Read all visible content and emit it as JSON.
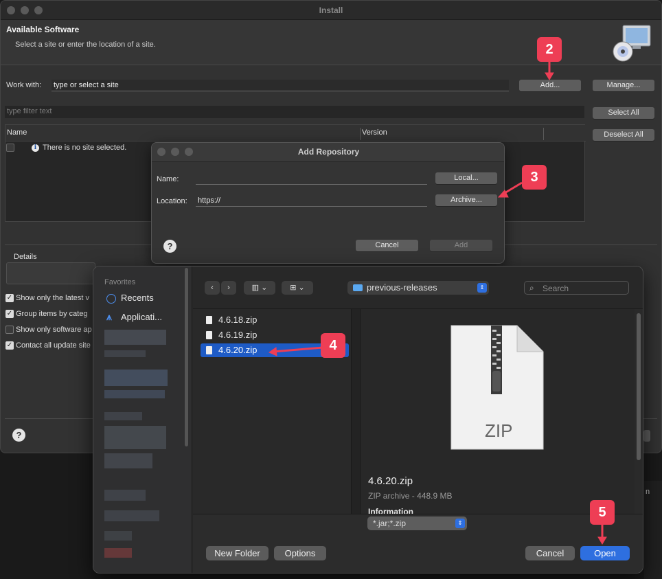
{
  "install": {
    "title": "Install",
    "heading": "Available Software",
    "subheading": "Select a site or enter the location of a site.",
    "work_with_label": "Work with:",
    "work_with_value": "type or select a site",
    "add_button": "Add...",
    "manage_button": "Manage...",
    "filter_placeholder": "type filter text",
    "select_all": "Select All",
    "deselect_all": "Deselect All",
    "columns": [
      "Name",
      "Version"
    ],
    "empty_message": "There is no site selected.",
    "details_label": "Details",
    "options": [
      {
        "label": "Show only the latest v",
        "checked": true
      },
      {
        "label": "Group items by categ",
        "checked": true
      },
      {
        "label": "Show only software ap",
        "checked": false
      },
      {
        "label": "Contact all update site",
        "checked": true
      }
    ]
  },
  "repo_dialog": {
    "title": "Add Repository",
    "name_label": "Name:",
    "name_value": "",
    "location_label": "Location:",
    "location_value": "https://",
    "local_button": "Local...",
    "archive_button": "Archive...",
    "cancel_button": "Cancel",
    "add_button": "Add"
  },
  "file_dialog": {
    "sidebar_section": "Favorites",
    "sidebar_items": [
      "Recents",
      "Applicati..."
    ],
    "current_folder": "previous-releases",
    "search_placeholder": "Search",
    "files": [
      {
        "name": "4.6.18.zip",
        "selected": false
      },
      {
        "name": "4.6.19.zip",
        "selected": false
      },
      {
        "name": "4.6.20.zip",
        "selected": true
      }
    ],
    "preview_badge": "ZIP",
    "preview_name": "4.6.20.zip",
    "preview_kind": "ZIP archive - 448.9 MB",
    "preview_info": "Information",
    "filter_value": "*.jar;*.zip",
    "new_folder_button": "New Folder",
    "options_button": "Options",
    "cancel_button": "Cancel",
    "open_button": "Open"
  },
  "callouts": [
    "2",
    "3",
    "4",
    "5"
  ],
  "colors": {
    "callout": "#ee3e55",
    "selection": "#1e5bc6",
    "primary_button": "#2e6fe0"
  }
}
